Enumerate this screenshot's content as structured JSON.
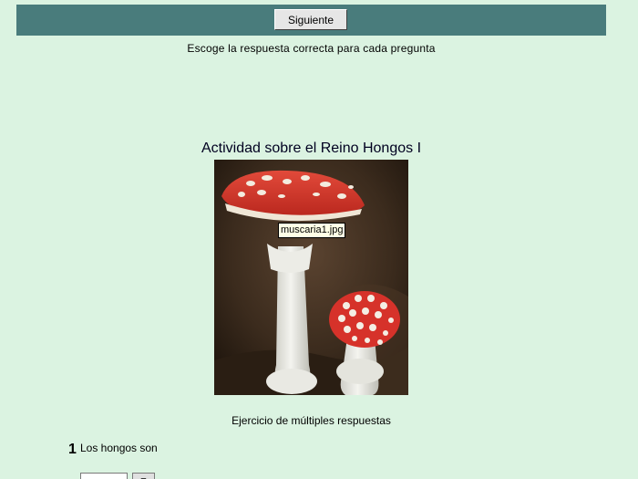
{
  "nav": {
    "next_label": "Siguiente"
  },
  "instructions": "Escoge la respuesta correcta para cada pregunta",
  "activity": {
    "title": "Actividad sobre el Reino Hongos I",
    "image_tooltip": "muscaria1.jpg",
    "exercise_label": "Ejercicio de múltiples respuestas"
  },
  "question": {
    "number": "1",
    "text": "Los hongos son"
  },
  "colors": {
    "background": "#dbf3e1",
    "nav_bar": "#497c7c"
  }
}
